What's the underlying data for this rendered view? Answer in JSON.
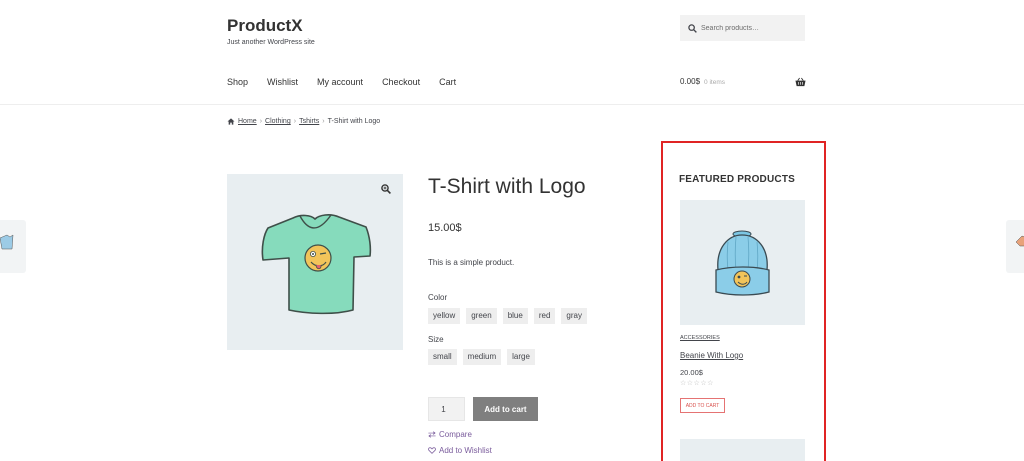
{
  "site": {
    "title": "ProductX",
    "tagline": "Just another WordPress site"
  },
  "search": {
    "placeholder": "Search products…"
  },
  "nav": {
    "items": [
      "Shop",
      "Wishlist",
      "My account",
      "Checkout",
      "Cart"
    ]
  },
  "cart": {
    "total": "0.00$",
    "count": "0 items"
  },
  "breadcrumb": {
    "home": "Home",
    "category": "Clothing",
    "subcategory": "Tshirts",
    "current": "T-Shirt with Logo"
  },
  "product": {
    "title": "T-Shirt with Logo",
    "price": "15.00$",
    "description": "This is a simple product.",
    "color_label": "Color",
    "colors": [
      "yellow",
      "green",
      "blue",
      "red",
      "gray"
    ],
    "size_label": "Size",
    "sizes": [
      "small",
      "medium",
      "large"
    ],
    "quantity": "1",
    "add_to_cart": "Add to cart",
    "compare": "Compare",
    "wishlist": "Add to Wishlist",
    "image_icon": "tshirt-icon"
  },
  "sidebar": {
    "heading": "FEATURED PRODUCTS",
    "featured": {
      "category": "ACCESSORIES",
      "name": "Beanie With Logo",
      "price": "20.00$",
      "rating_stars": "☆☆☆☆☆",
      "button": "ADD TO CART",
      "image_icon": "beanie-icon"
    }
  },
  "colors": {
    "highlight_border": "#e02424",
    "link_purple": "#7a5c9c",
    "button_gray": "#7f7f7f",
    "image_bg": "#e8eef1"
  }
}
